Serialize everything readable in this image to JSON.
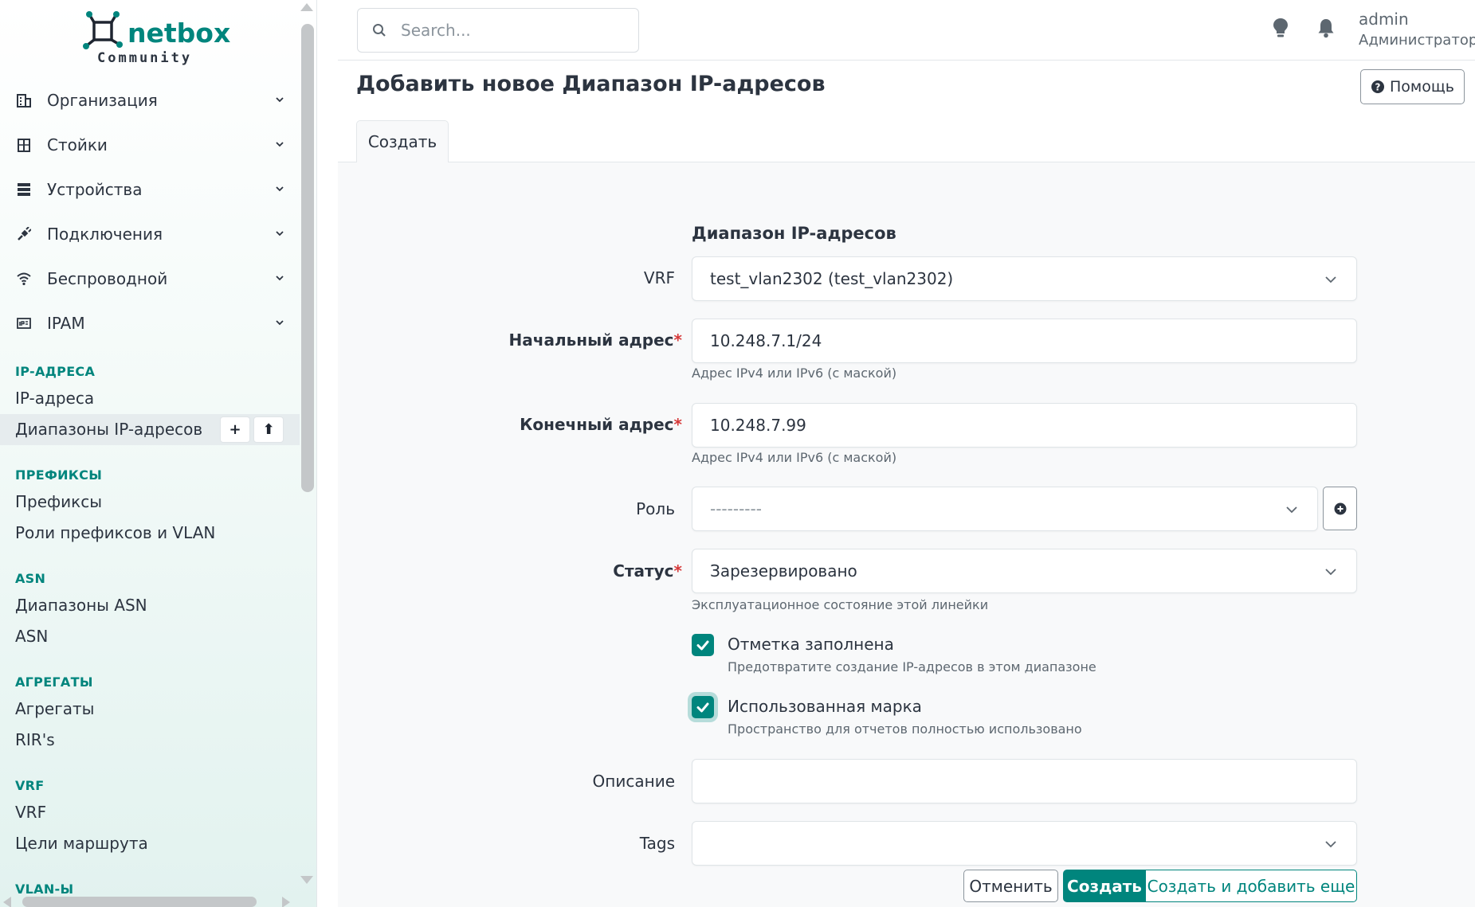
{
  "brand": {
    "name": "netbox",
    "edition": "Community",
    "accent": "#00857d"
  },
  "sidebar": {
    "menu": [
      {
        "label": "Организация",
        "icon": "building-icon"
      },
      {
        "label": "Стойки",
        "icon": "rack-icon"
      },
      {
        "label": "Устройства",
        "icon": "server-icon"
      },
      {
        "label": "Подключения",
        "icon": "plug-icon"
      },
      {
        "label": "Беспроводной",
        "icon": "wifi-icon"
      },
      {
        "label": "IPAM",
        "icon": "ipam-icon"
      }
    ],
    "sections": [
      {
        "title": "IP-АДРЕСА",
        "links": [
          "IP-адреса",
          "Диапазоны IP-адресов"
        ]
      },
      {
        "title": "ПРЕФИКСЫ",
        "links": [
          "Префиксы",
          "Роли префиксов и VLAN"
        ]
      },
      {
        "title": "ASN",
        "links": [
          "Диапазоны ASN",
          "ASN"
        ]
      },
      {
        "title": "АГРЕГАТЫ",
        "links": [
          "Агрегаты",
          "RIR's"
        ]
      },
      {
        "title": "VRF",
        "links": [
          "VRF",
          "Цели маршрута"
        ]
      },
      {
        "title": "VLAN-Ы",
        "links": []
      }
    ],
    "active_link_buttons": {
      "add": "+",
      "import": "⬆"
    }
  },
  "header": {
    "search_placeholder": "Search...",
    "user_name": "admin",
    "user_role": "Администратор"
  },
  "page": {
    "title": "Добавить новое Диапазон IP-адресов",
    "help_label": "Помощь",
    "tab_label": "Создать"
  },
  "form": {
    "section_title": "Диапазон IP-адресов",
    "vrf": {
      "label": "VRF",
      "value": "test_vlan2302 (test_vlan2302)"
    },
    "start_address": {
      "label": "Начальный адрес",
      "value": "10.248.7.1/24",
      "hint": "Адрес IPv4 или IPv6 (с маской)"
    },
    "end_address": {
      "label": "Конечный адрес",
      "value": "10.248.7.99",
      "hint": "Адрес IPv4 или IPv6 (с маской)"
    },
    "role": {
      "label": "Роль",
      "value": "---------"
    },
    "status": {
      "label": "Статус",
      "value": "Зарезервировано",
      "hint": "Эксплуатационное состояние этой линейки"
    },
    "mark_populated": {
      "label": "Отметка заполнена",
      "hint": "Предотвратите создание IP-адресов в этом диапазоне",
      "checked": true
    },
    "mark_utilized": {
      "label": "Использованная марка",
      "hint": "Пространство для отчетов полностью использовано",
      "checked": true
    },
    "description": {
      "label": "Описание",
      "value": ""
    },
    "tags": {
      "label": "Tags",
      "value": ""
    },
    "required_mark": "*"
  },
  "actions": {
    "cancel": "Отменить",
    "create": "Создать",
    "create_and_add": "Создать и добавить еще"
  }
}
